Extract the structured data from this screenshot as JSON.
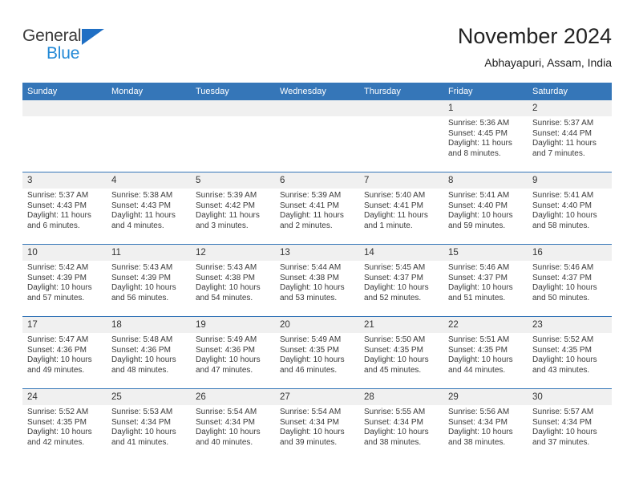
{
  "brand": {
    "name_part1": "General",
    "name_part2": "Blue",
    "triangle_color": "#1f6fc4",
    "blue_color": "#2389d6"
  },
  "header": {
    "title": "November 2024",
    "subtitle": "Abhayapuri, Assam, India"
  },
  "theme": {
    "header_blue": "#3576b8",
    "day_header_gray": "#f0f0f0"
  },
  "weekdays": [
    "Sunday",
    "Monday",
    "Tuesday",
    "Wednesday",
    "Thursday",
    "Friday",
    "Saturday"
  ],
  "labels": {
    "sunrise_prefix": "Sunrise: ",
    "sunset_prefix": "Sunset: ",
    "daylight_prefix": "Daylight: "
  },
  "weeks": [
    [
      {
        "day": "",
        "empty": true
      },
      {
        "day": "",
        "empty": true
      },
      {
        "day": "",
        "empty": true
      },
      {
        "day": "",
        "empty": true
      },
      {
        "day": "",
        "empty": true
      },
      {
        "day": "1",
        "sunrise": "Sunrise: 5:36 AM",
        "sunset": "Sunset: 4:45 PM",
        "daylight1": "Daylight: 11 hours",
        "daylight2": "and 8 minutes."
      },
      {
        "day": "2",
        "sunrise": "Sunrise: 5:37 AM",
        "sunset": "Sunset: 4:44 PM",
        "daylight1": "Daylight: 11 hours",
        "daylight2": "and 7 minutes."
      }
    ],
    [
      {
        "day": "3",
        "sunrise": "Sunrise: 5:37 AM",
        "sunset": "Sunset: 4:43 PM",
        "daylight1": "Daylight: 11 hours",
        "daylight2": "and 6 minutes."
      },
      {
        "day": "4",
        "sunrise": "Sunrise: 5:38 AM",
        "sunset": "Sunset: 4:43 PM",
        "daylight1": "Daylight: 11 hours",
        "daylight2": "and 4 minutes."
      },
      {
        "day": "5",
        "sunrise": "Sunrise: 5:39 AM",
        "sunset": "Sunset: 4:42 PM",
        "daylight1": "Daylight: 11 hours",
        "daylight2": "and 3 minutes."
      },
      {
        "day": "6",
        "sunrise": "Sunrise: 5:39 AM",
        "sunset": "Sunset: 4:41 PM",
        "daylight1": "Daylight: 11 hours",
        "daylight2": "and 2 minutes."
      },
      {
        "day": "7",
        "sunrise": "Sunrise: 5:40 AM",
        "sunset": "Sunset: 4:41 PM",
        "daylight1": "Daylight: 11 hours",
        "daylight2": "and 1 minute."
      },
      {
        "day": "8",
        "sunrise": "Sunrise: 5:41 AM",
        "sunset": "Sunset: 4:40 PM",
        "daylight1": "Daylight: 10 hours",
        "daylight2": "and 59 minutes."
      },
      {
        "day": "9",
        "sunrise": "Sunrise: 5:41 AM",
        "sunset": "Sunset: 4:40 PM",
        "daylight1": "Daylight: 10 hours",
        "daylight2": "and 58 minutes."
      }
    ],
    [
      {
        "day": "10",
        "sunrise": "Sunrise: 5:42 AM",
        "sunset": "Sunset: 4:39 PM",
        "daylight1": "Daylight: 10 hours",
        "daylight2": "and 57 minutes."
      },
      {
        "day": "11",
        "sunrise": "Sunrise: 5:43 AM",
        "sunset": "Sunset: 4:39 PM",
        "daylight1": "Daylight: 10 hours",
        "daylight2": "and 56 minutes."
      },
      {
        "day": "12",
        "sunrise": "Sunrise: 5:43 AM",
        "sunset": "Sunset: 4:38 PM",
        "daylight1": "Daylight: 10 hours",
        "daylight2": "and 54 minutes."
      },
      {
        "day": "13",
        "sunrise": "Sunrise: 5:44 AM",
        "sunset": "Sunset: 4:38 PM",
        "daylight1": "Daylight: 10 hours",
        "daylight2": "and 53 minutes."
      },
      {
        "day": "14",
        "sunrise": "Sunrise: 5:45 AM",
        "sunset": "Sunset: 4:37 PM",
        "daylight1": "Daylight: 10 hours",
        "daylight2": "and 52 minutes."
      },
      {
        "day": "15",
        "sunrise": "Sunrise: 5:46 AM",
        "sunset": "Sunset: 4:37 PM",
        "daylight1": "Daylight: 10 hours",
        "daylight2": "and 51 minutes."
      },
      {
        "day": "16",
        "sunrise": "Sunrise: 5:46 AM",
        "sunset": "Sunset: 4:37 PM",
        "daylight1": "Daylight: 10 hours",
        "daylight2": "and 50 minutes."
      }
    ],
    [
      {
        "day": "17",
        "sunrise": "Sunrise: 5:47 AM",
        "sunset": "Sunset: 4:36 PM",
        "daylight1": "Daylight: 10 hours",
        "daylight2": "and 49 minutes."
      },
      {
        "day": "18",
        "sunrise": "Sunrise: 5:48 AM",
        "sunset": "Sunset: 4:36 PM",
        "daylight1": "Daylight: 10 hours",
        "daylight2": "and 48 minutes."
      },
      {
        "day": "19",
        "sunrise": "Sunrise: 5:49 AM",
        "sunset": "Sunset: 4:36 PM",
        "daylight1": "Daylight: 10 hours",
        "daylight2": "and 47 minutes."
      },
      {
        "day": "20",
        "sunrise": "Sunrise: 5:49 AM",
        "sunset": "Sunset: 4:35 PM",
        "daylight1": "Daylight: 10 hours",
        "daylight2": "and 46 minutes."
      },
      {
        "day": "21",
        "sunrise": "Sunrise: 5:50 AM",
        "sunset": "Sunset: 4:35 PM",
        "daylight1": "Daylight: 10 hours",
        "daylight2": "and 45 minutes."
      },
      {
        "day": "22",
        "sunrise": "Sunrise: 5:51 AM",
        "sunset": "Sunset: 4:35 PM",
        "daylight1": "Daylight: 10 hours",
        "daylight2": "and 44 minutes."
      },
      {
        "day": "23",
        "sunrise": "Sunrise: 5:52 AM",
        "sunset": "Sunset: 4:35 PM",
        "daylight1": "Daylight: 10 hours",
        "daylight2": "and 43 minutes."
      }
    ],
    [
      {
        "day": "24",
        "sunrise": "Sunrise: 5:52 AM",
        "sunset": "Sunset: 4:35 PM",
        "daylight1": "Daylight: 10 hours",
        "daylight2": "and 42 minutes."
      },
      {
        "day": "25",
        "sunrise": "Sunrise: 5:53 AM",
        "sunset": "Sunset: 4:34 PM",
        "daylight1": "Daylight: 10 hours",
        "daylight2": "and 41 minutes."
      },
      {
        "day": "26",
        "sunrise": "Sunrise: 5:54 AM",
        "sunset": "Sunset: 4:34 PM",
        "daylight1": "Daylight: 10 hours",
        "daylight2": "and 40 minutes."
      },
      {
        "day": "27",
        "sunrise": "Sunrise: 5:54 AM",
        "sunset": "Sunset: 4:34 PM",
        "daylight1": "Daylight: 10 hours",
        "daylight2": "and 39 minutes."
      },
      {
        "day": "28",
        "sunrise": "Sunrise: 5:55 AM",
        "sunset": "Sunset: 4:34 PM",
        "daylight1": "Daylight: 10 hours",
        "daylight2": "and 38 minutes."
      },
      {
        "day": "29",
        "sunrise": "Sunrise: 5:56 AM",
        "sunset": "Sunset: 4:34 PM",
        "daylight1": "Daylight: 10 hours",
        "daylight2": "and 38 minutes."
      },
      {
        "day": "30",
        "sunrise": "Sunrise: 5:57 AM",
        "sunset": "Sunset: 4:34 PM",
        "daylight1": "Daylight: 10 hours",
        "daylight2": "and 37 minutes."
      }
    ]
  ]
}
